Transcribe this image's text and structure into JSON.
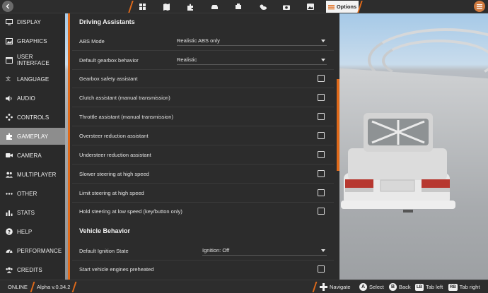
{
  "topbar": {
    "tabs": [
      {
        "icon": "gauge-grid-icon"
      },
      {
        "icon": "map-icon"
      },
      {
        "icon": "puzzle-icon"
      },
      {
        "icon": "car-icon"
      },
      {
        "icon": "engine-icon"
      },
      {
        "icon": "weather-icon"
      },
      {
        "icon": "camera-icon"
      },
      {
        "icon": "photo-icon"
      }
    ],
    "active_tab_label": "Options"
  },
  "sidebar": {
    "items": [
      {
        "label": "DISPLAY",
        "icon": "monitor-icon"
      },
      {
        "label": "GRAPHICS",
        "icon": "image-icon"
      },
      {
        "label": "USER INTERFACE",
        "icon": "window-icon"
      },
      {
        "label": "LANGUAGE",
        "icon": "translate-icon"
      },
      {
        "label": "AUDIO",
        "icon": "speaker-icon"
      },
      {
        "label": "CONTROLS",
        "icon": "gamepad-icon"
      },
      {
        "label": "GAMEPLAY",
        "icon": "puzzle-icon"
      },
      {
        "label": "CAMERA",
        "icon": "video-camera-icon"
      },
      {
        "label": "MULTIPLAYER",
        "icon": "people-icon"
      },
      {
        "label": "OTHER",
        "icon": "dots-icon"
      },
      {
        "label": "STATS",
        "icon": "bar-chart-icon"
      },
      {
        "label": "HELP",
        "icon": "help-icon"
      },
      {
        "label": "PERFORMANCE",
        "icon": "speedometer-icon"
      },
      {
        "label": "CREDITS",
        "icon": "group-icon"
      }
    ],
    "active": "GAMEPLAY"
  },
  "main": {
    "section1_title": "Driving Assistants",
    "abs_mode": {
      "label": "ABS Mode",
      "value": "Realistic ABS only"
    },
    "gearbox": {
      "label": "Default gearbox behavior",
      "value": "Realistic"
    },
    "checkboxes": [
      {
        "label": "Gearbox safety assistant",
        "checked": false
      },
      {
        "label": "Clutch assistant (manual transmission)",
        "checked": false
      },
      {
        "label": "Throttle assistant (manual transmission)",
        "checked": false
      },
      {
        "label": "Oversteer reduction assistant",
        "checked": false
      },
      {
        "label": "Understeer reduction assistant",
        "checked": false
      },
      {
        "label": "Slower steering at high speed",
        "checked": false
      },
      {
        "label": "Limit steering at high speed",
        "checked": false
      },
      {
        "label": "Hold steering at low speed (key/button only)",
        "checked": false
      }
    ],
    "section2_title": "Vehicle Behavior",
    "ignition": {
      "label": "Default Ignition State",
      "value": "Ignition: Off"
    },
    "preheat": {
      "label": "Start vehicle engines preheated",
      "checked": false
    }
  },
  "bottombar": {
    "status": "ONLINE",
    "version": "Alpha v.0.34.2",
    "hints": [
      {
        "key": "dpad",
        "label": "Navigate"
      },
      {
        "key": "A",
        "label": "Select"
      },
      {
        "key": "B",
        "label": "Back"
      },
      {
        "key": "LB",
        "label": "Tab left"
      },
      {
        "key": "RB",
        "label": "Tab right"
      }
    ]
  },
  "colors": {
    "accent": "#e06a1a",
    "panel": "#2c2c2c",
    "sidebar": "#2a2a2a",
    "active_item": "#8d8d8d"
  }
}
